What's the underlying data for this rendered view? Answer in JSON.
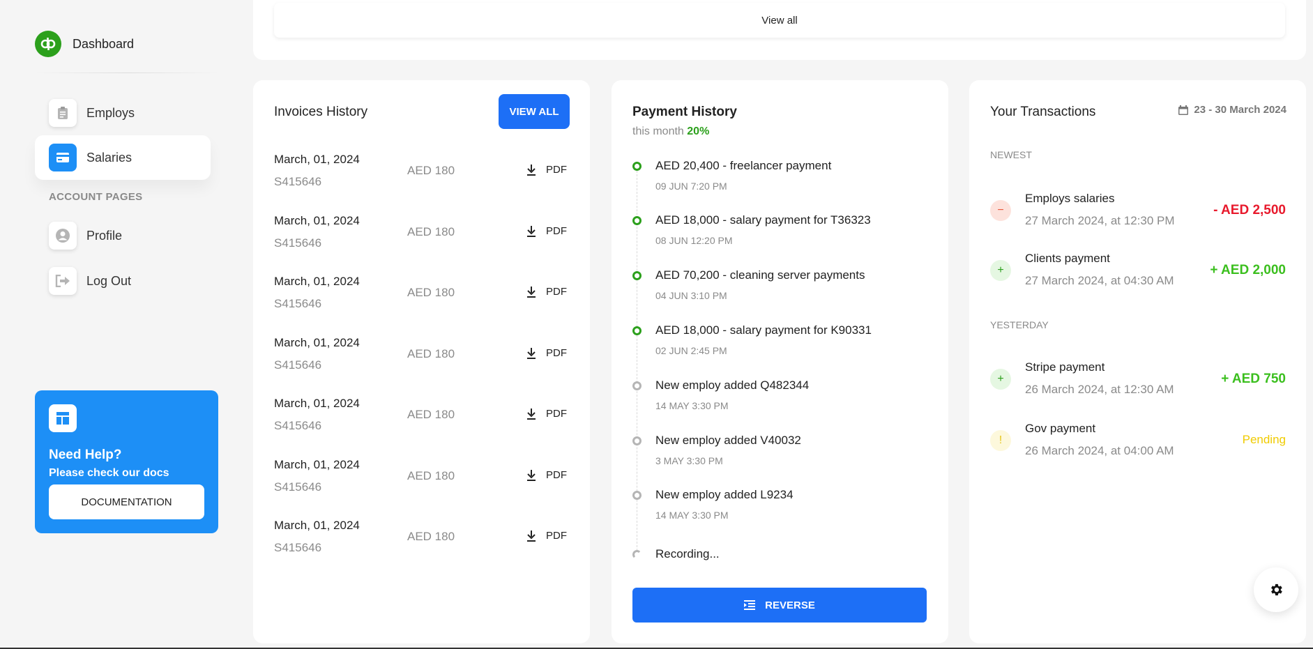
{
  "sidebar": {
    "brand": "Dashboard",
    "items": [
      {
        "label": "Employs",
        "icon": "clipboard-icon"
      },
      {
        "label": "Salaries",
        "icon": "credit-card-icon",
        "active": true
      },
      {
        "label": "Profile",
        "icon": "user-icon"
      },
      {
        "label": "Log Out",
        "icon": "logout-icon"
      }
    ],
    "section_title": "ACCOUNT PAGES",
    "help": {
      "title": "Need Help?",
      "subtitle": "Please check our docs",
      "button": "DOCUMENTATION"
    }
  },
  "top": {
    "view_all": "View all"
  },
  "invoices": {
    "title": "Invoices History",
    "view_all": "VIEW ALL",
    "rows": [
      {
        "date": "March, 01, 2024",
        "id": "S415646",
        "amount": "AED 180",
        "pdf": "PDF"
      },
      {
        "date": "March, 01, 2024",
        "id": "S415646",
        "amount": "AED 180",
        "pdf": "PDF"
      },
      {
        "date": "March, 01, 2024",
        "id": "S415646",
        "amount": "AED 180",
        "pdf": "PDF"
      },
      {
        "date": "March, 01, 2024",
        "id": "S415646",
        "amount": "AED 180",
        "pdf": "PDF"
      },
      {
        "date": "March, 01, 2024",
        "id": "S415646",
        "amount": "AED 180",
        "pdf": "PDF"
      },
      {
        "date": "March, 01, 2024",
        "id": "S415646",
        "amount": "AED 180",
        "pdf": "PDF"
      },
      {
        "date": "March, 01, 2024",
        "id": "S415646",
        "amount": "AED 180",
        "pdf": "PDF"
      }
    ]
  },
  "payments": {
    "title": "Payment History",
    "subtitle_prefix": "this month",
    "subtitle_pct": "20%",
    "items": [
      {
        "title": "AED 20,400 - freelancer payment",
        "time": "09 JUN 7:20 PM",
        "status": "done"
      },
      {
        "title": "AED 18,000 - salary payment for T36323",
        "time": "08 JUN 12:20 PM",
        "status": "done"
      },
      {
        "title": "AED 70,200 - cleaning server payments",
        "time": "04 JUN 3:10 PM",
        "status": "done"
      },
      {
        "title": "AED 18,000 - salary payment for K90331",
        "time": "02 JUN 2:45 PM",
        "status": "done"
      },
      {
        "title": "New employ added Q482344",
        "time": "14 MAY 3:30 PM",
        "status": "grey"
      },
      {
        "title": "New employ added V40032",
        "time": "3 MAY 3:30 PM",
        "status": "grey"
      },
      {
        "title": "New employ added L9234",
        "time": "14 MAY 3:30 PM",
        "status": "grey"
      },
      {
        "title": "Recording...",
        "time": "",
        "status": "partial"
      }
    ],
    "reverse_button": "REVERSE"
  },
  "transactions": {
    "title": "Your Transactions",
    "date_range": "23 - 30 March 2024",
    "groups": [
      {
        "label": "NEWEST",
        "items": [
          {
            "title": "Employs salaries",
            "time": "27 March 2024, at 12:30 PM",
            "amount": "- AED 2,500",
            "kind": "neg",
            "sign": "−"
          },
          {
            "title": "Clients payment",
            "time": "27 March 2024, at 04:30 AM",
            "amount": "+ AED 2,000",
            "kind": "pos",
            "sign": "+"
          }
        ]
      },
      {
        "label": "YESTERDAY",
        "items": [
          {
            "title": "Stripe payment",
            "time": "26 March 2024, at 12:30 AM",
            "amount": "+ AED 750",
            "kind": "pos",
            "sign": "+"
          },
          {
            "title": "Gov payment",
            "time": "26 March 2024, at 04:00 AM",
            "amount": "Pending",
            "kind": "pend",
            "sign": "!"
          }
        ]
      }
    ]
  },
  "colors": {
    "primary": "#1d6ff6",
    "sidebar_accent": "#1d8ff6",
    "positive": "#3bbf1e",
    "negative": "#e8192c",
    "pending": "#f0cb00"
  }
}
